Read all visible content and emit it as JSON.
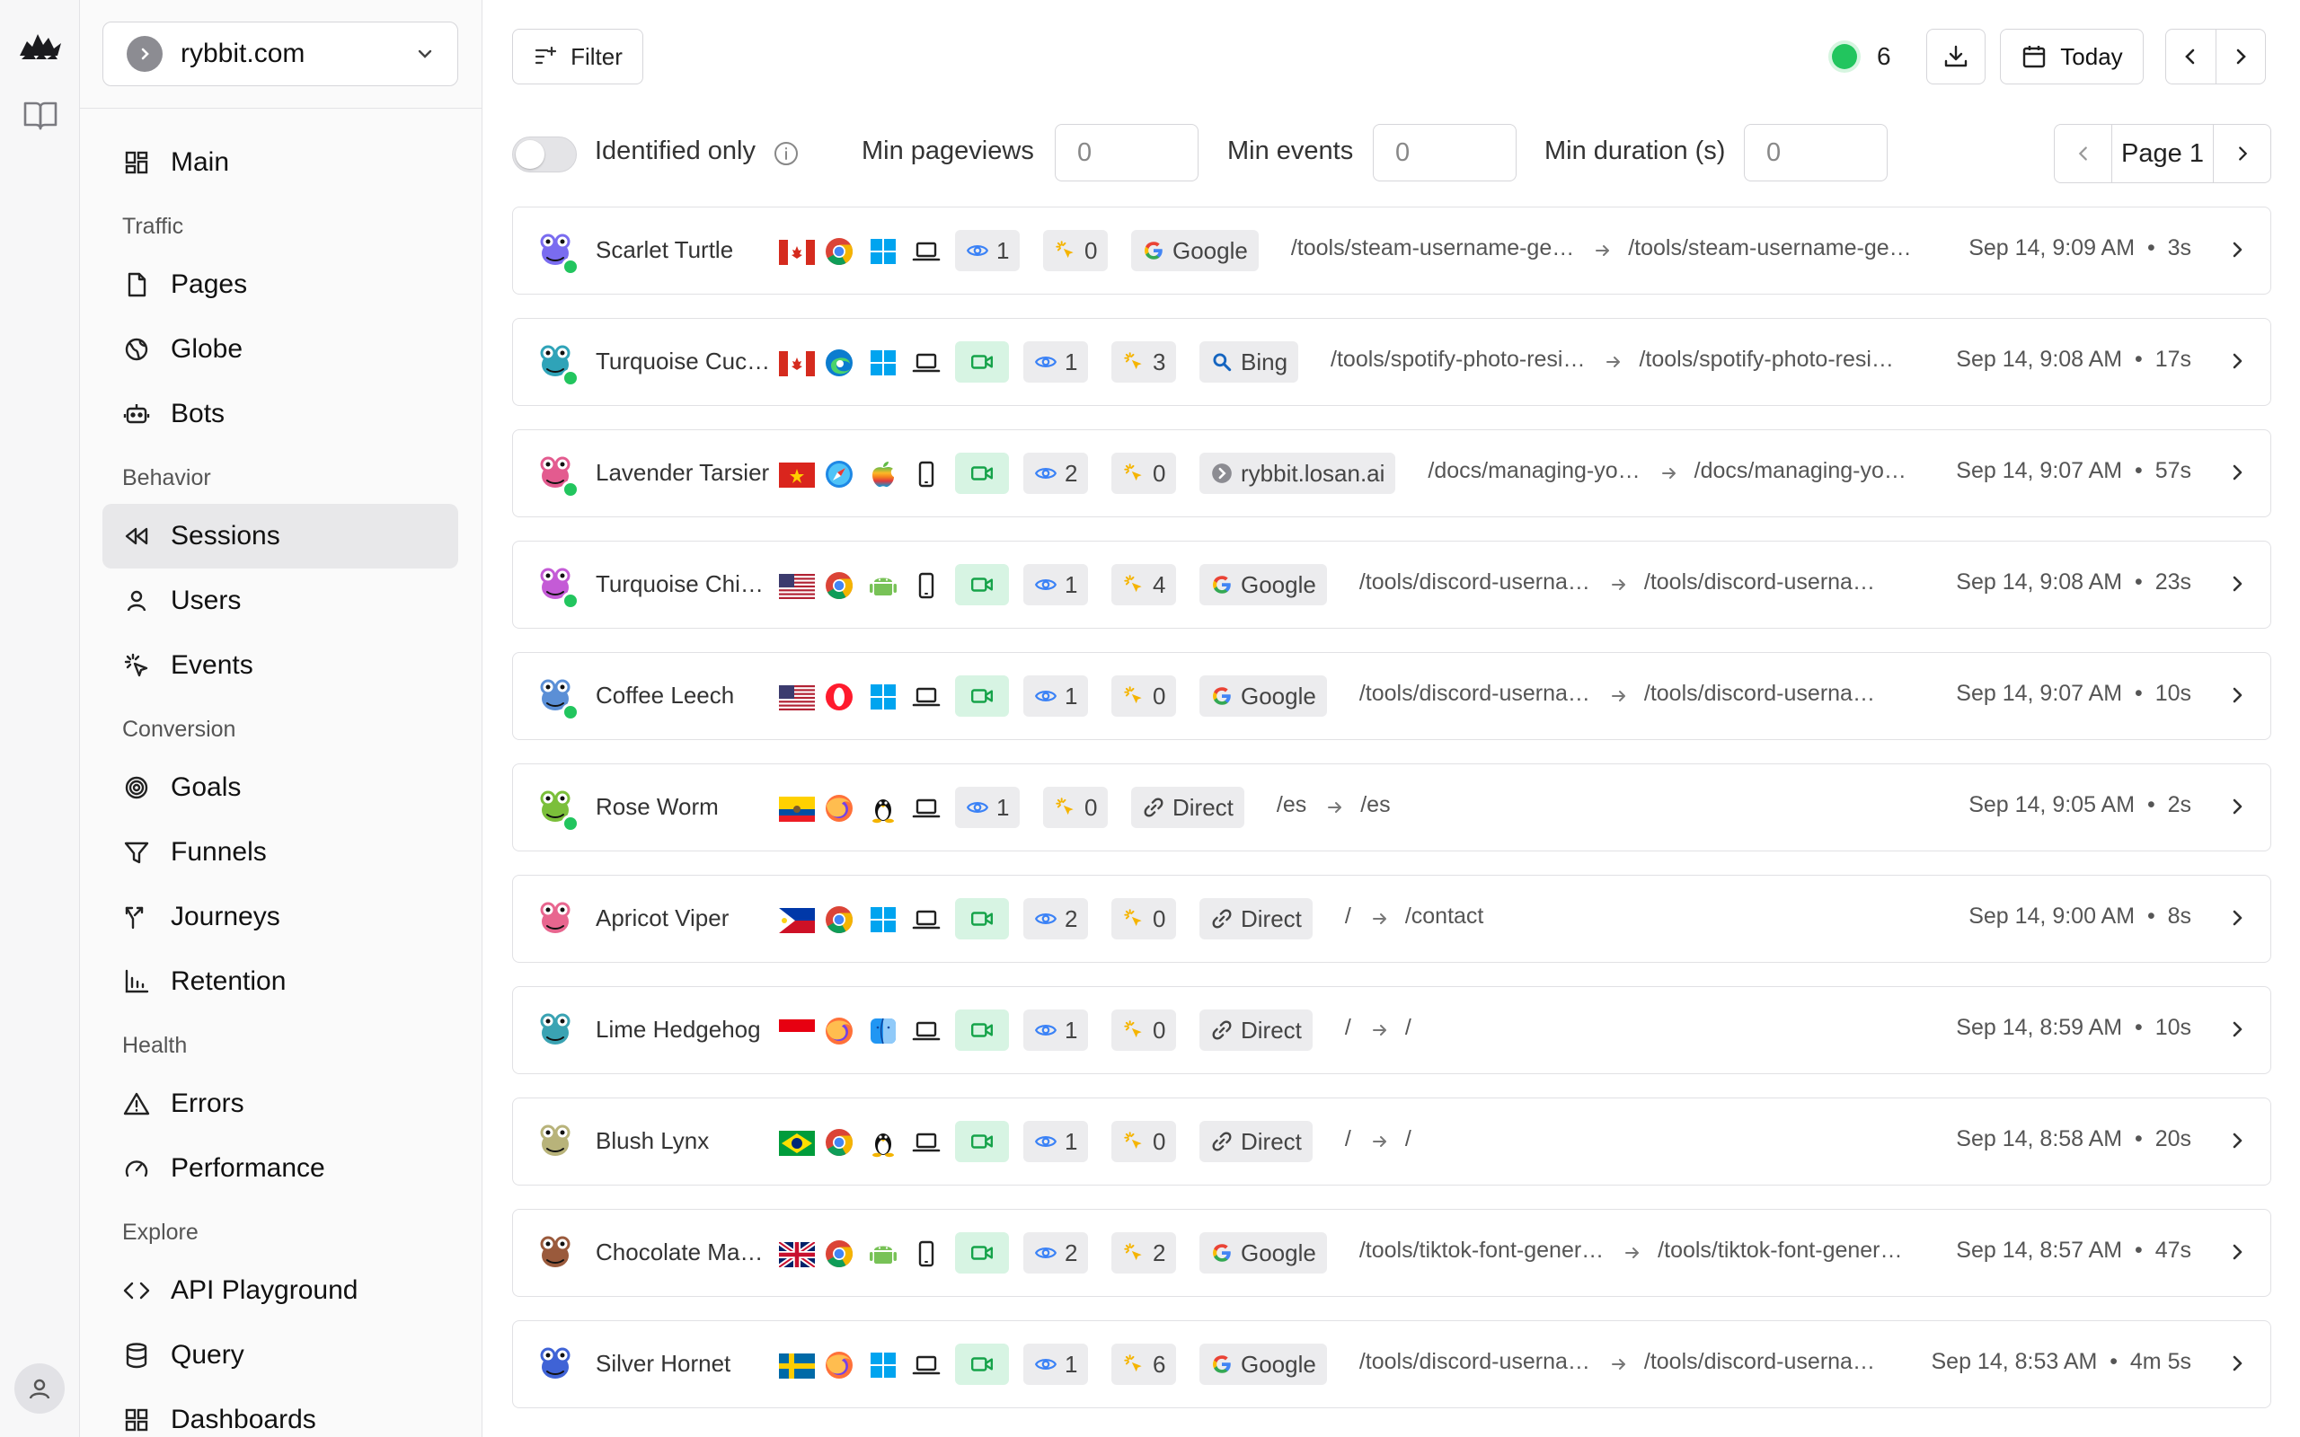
{
  "app": {
    "site": "rybbit.com"
  },
  "sidebar": {
    "main_label": "Main",
    "sections": {
      "traffic": "Traffic",
      "behavior": "Behavior",
      "conversion": "Conversion",
      "health": "Health",
      "explore": "Explore"
    },
    "items": {
      "pages": "Pages",
      "globe": "Globe",
      "bots": "Bots",
      "sessions": "Sessions",
      "users": "Users",
      "events": "Events",
      "goals": "Goals",
      "funnels": "Funnels",
      "journeys": "Journeys",
      "retention": "Retention",
      "errors": "Errors",
      "performance": "Performance",
      "api_playground": "API Playground",
      "query": "Query",
      "dashboards": "Dashboards"
    },
    "active": "sessions"
  },
  "toolbar": {
    "filter_label": "Filter",
    "live_count": "6",
    "date_label": "Today"
  },
  "filters": {
    "identified_label": "Identified only",
    "identified_on": false,
    "min_pageviews_label": "Min pageviews",
    "min_pageviews_value": "0",
    "min_events_label": "Min events",
    "min_events_value": "0",
    "min_duration_label": "Min duration (s)",
    "min_duration_value": "0",
    "page_label": "Page 1"
  },
  "colors": {
    "accent_green": "#22c55e",
    "recording_bg": "#d7f4e3",
    "event_icon": "#f5b400",
    "view_icon": "#3b82f6"
  },
  "sessions": [
    {
      "name": "Scarlet Turtle",
      "online": true,
      "flag": "CA",
      "browser": "chrome",
      "os": "windows",
      "device": "desktop",
      "recording": false,
      "pageviews": "1",
      "events": "0",
      "referrer": "Google",
      "referrer_icon": "google-icon",
      "entry": "/tools/steam-username-ge…",
      "exit": "/tools/steam-username-ge…",
      "time": "Sep 14, 9:09 AM",
      "duration": "3s",
      "avatar_color": "#7a6cf0"
    },
    {
      "name": "Turquoise Cuc…",
      "online": true,
      "flag": "CA",
      "browser": "edge",
      "os": "windows",
      "device": "desktop",
      "recording": true,
      "pageviews": "1",
      "events": "3",
      "referrer": "Bing",
      "referrer_icon": "bing-search-icon",
      "entry": "/tools/spotify-photo-resi…",
      "exit": "/tools/spotify-photo-resi…",
      "time": "Sep 14, 9:08 AM",
      "duration": "17s",
      "avatar_color": "#2fa3b8"
    },
    {
      "name": "Lavender Tarsier",
      "online": true,
      "flag": "VN",
      "browser": "safari",
      "os": "apple",
      "device": "mobile",
      "recording": true,
      "pageviews": "2",
      "events": "0",
      "referrer": "rybbit.losan.ai",
      "referrer_icon": "site-favicon-icon",
      "entry": "/docs/managing-yo…",
      "exit": "/docs/managing-yo…",
      "time": "Sep 14, 9:07 AM",
      "duration": "57s",
      "avatar_color": "#e35b8f"
    },
    {
      "name": "Turquoise Chi…",
      "online": true,
      "flag": "US",
      "browser": "chrome",
      "os": "android",
      "device": "mobile",
      "recording": true,
      "pageviews": "1",
      "events": "4",
      "referrer": "Google",
      "referrer_icon": "google-icon",
      "entry": "/tools/discord-userna…",
      "exit": "/tools/discord-userna…",
      "time": "Sep 14, 9:08 AM",
      "duration": "23s",
      "avatar_color": "#c45bd6"
    },
    {
      "name": "Coffee Leech",
      "online": true,
      "flag": "US",
      "browser": "opera",
      "os": "windows",
      "device": "desktop",
      "recording": true,
      "pageviews": "1",
      "events": "0",
      "referrer": "Google",
      "referrer_icon": "google-icon",
      "entry": "/tools/discord-userna…",
      "exit": "/tools/discord-userna…",
      "time": "Sep 14, 9:07 AM",
      "duration": "10s",
      "avatar_color": "#5b8fd6"
    },
    {
      "name": "Rose Worm",
      "online": true,
      "flag": "EC",
      "browser": "firefox",
      "os": "linux",
      "device": "desktop",
      "recording": false,
      "pageviews": "1",
      "events": "0",
      "referrer": "Direct",
      "referrer_icon": "link-icon",
      "entry": "/es",
      "exit": "/es",
      "time": "Sep 14, 9:05 AM",
      "duration": "2s",
      "avatar_color": "#7bbf3a"
    },
    {
      "name": "Apricot Viper",
      "online": false,
      "flag": "PH",
      "browser": "chrome",
      "os": "windows",
      "device": "desktop",
      "recording": true,
      "pageviews": "2",
      "events": "0",
      "referrer": "Direct",
      "referrer_icon": "link-icon",
      "entry": "/",
      "exit": "/contact",
      "time": "Sep 14, 9:00 AM",
      "duration": "8s",
      "avatar_color": "#e8668f"
    },
    {
      "name": "Lime Hedgehog",
      "online": false,
      "flag": "ID",
      "browser": "firefox",
      "os": "macos",
      "device": "desktop",
      "recording": true,
      "pageviews": "1",
      "events": "0",
      "referrer": "Direct",
      "referrer_icon": "link-icon",
      "entry": "/",
      "exit": "/",
      "time": "Sep 14, 8:59 AM",
      "duration": "10s",
      "avatar_color": "#3aa3b3"
    },
    {
      "name": "Blush Lynx",
      "online": false,
      "flag": "BR",
      "browser": "chrome",
      "os": "linux",
      "device": "desktop",
      "recording": true,
      "pageviews": "1",
      "events": "0",
      "referrer": "Direct",
      "referrer_icon": "link-icon",
      "entry": "/",
      "exit": "/",
      "time": "Sep 14, 8:58 AM",
      "duration": "20s",
      "avatar_color": "#b8b37a"
    },
    {
      "name": "Chocolate Ma…",
      "online": false,
      "flag": "GB",
      "browser": "chrome",
      "os": "android",
      "device": "mobile",
      "recording": true,
      "pageviews": "2",
      "events": "2",
      "referrer": "Google",
      "referrer_icon": "google-icon",
      "entry": "/tools/tiktok-font-gener…",
      "exit": "/tools/tiktok-font-gener…",
      "time": "Sep 14, 8:57 AM",
      "duration": "47s",
      "avatar_color": "#9a5a3c"
    },
    {
      "name": "Silver Hornet",
      "online": false,
      "flag": "SE",
      "browser": "firefox",
      "os": "windows",
      "device": "desktop",
      "recording": true,
      "pageviews": "1",
      "events": "6",
      "referrer": "Google",
      "referrer_icon": "google-icon",
      "entry": "/tools/discord-userna…",
      "exit": "/tools/discord-userna…",
      "time": "Sep 14, 8:53 AM",
      "duration": "4m 5s",
      "avatar_color": "#3f63d6"
    }
  ]
}
